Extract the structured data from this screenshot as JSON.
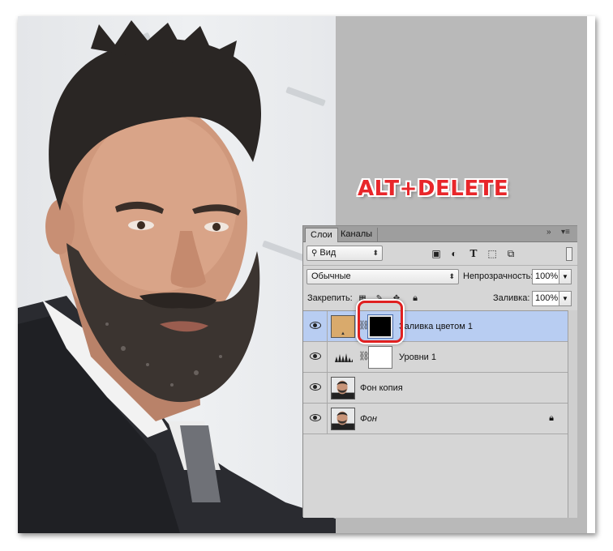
{
  "overlay": {
    "shortcut": "ALT+DELETE"
  },
  "panel": {
    "tabs": [
      "Слои",
      "Каналы"
    ],
    "menu_icons": {
      "collapse": "»",
      "menu": "▾≡"
    },
    "filter": {
      "label": "Вид",
      "icon": "search-icon"
    },
    "filter_icons": [
      "image-filter-icon",
      "adjustment-filter-icon",
      "type-filter-icon",
      "shape-filter-icon",
      "smart-object-filter-icon"
    ],
    "blend_mode": "Обычные",
    "opacity_label": "Непрозрачность:",
    "opacity_value": "100%",
    "lock_label": "Закрепить:",
    "fill_label": "Заливка:",
    "fill_value": "100%",
    "layers": [
      {
        "name": "Заливка цветом 1",
        "selected": true,
        "fill_color": "#d9aa6c",
        "mask_color": "#000000"
      },
      {
        "name": "Уровни 1",
        "selected": false
      },
      {
        "name": "Фон копия",
        "selected": false
      },
      {
        "name": "Фон",
        "selected": false,
        "locked": true
      }
    ]
  },
  "colors": {
    "highlight": "#e02020",
    "selection": "#b8cdf2"
  }
}
